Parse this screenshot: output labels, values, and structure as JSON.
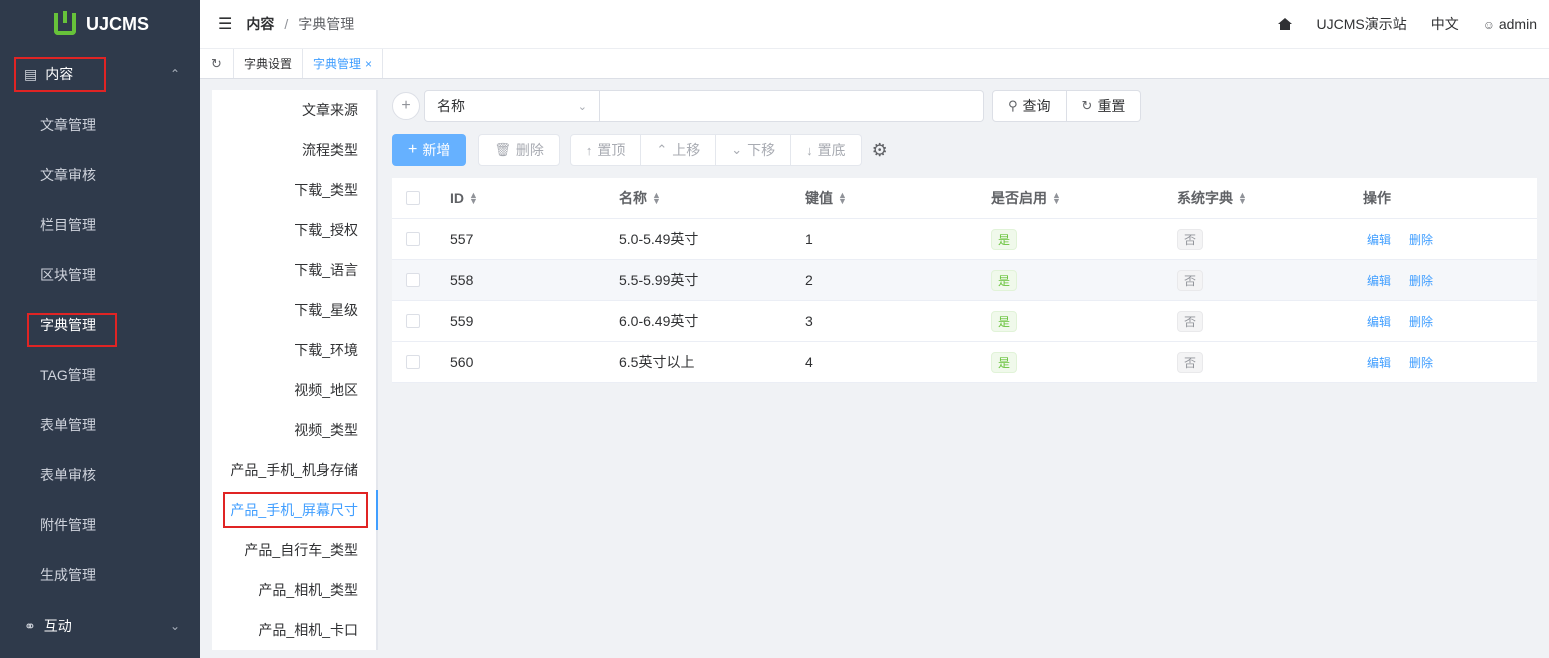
{
  "app": {
    "name": "UJCMS"
  },
  "sidebar": {
    "group_content": "内容",
    "items": [
      {
        "label": "文章管理"
      },
      {
        "label": "文章审核"
      },
      {
        "label": "栏目管理"
      },
      {
        "label": "区块管理"
      },
      {
        "label": "字典管理"
      },
      {
        "label": "TAG管理"
      },
      {
        "label": "表单管理"
      },
      {
        "label": "表单审核"
      },
      {
        "label": "附件管理"
      },
      {
        "label": "生成管理"
      }
    ],
    "group_interact": "互动"
  },
  "header": {
    "breadcrumb_root": "内容",
    "breadcrumb_sep": "/",
    "breadcrumb_current": "字典管理",
    "site": "UJCMS演示站",
    "lang": "中文",
    "user": "admin"
  },
  "tabs": [
    {
      "label": "字典设置"
    },
    {
      "label": "字典管理",
      "close": "×"
    }
  ],
  "dict_types": [
    "文章来源",
    "流程类型",
    "下载_类型",
    "下载_授权",
    "下载_语言",
    "下载_星级",
    "下载_环境",
    "视频_地区",
    "视频_类型",
    "产品_手机_机身存储",
    "产品_手机_屏幕尺寸",
    "产品_自行车_类型",
    "产品_相机_类型",
    "产品_相机_卡口"
  ],
  "search": {
    "field_selected": "名称",
    "query_label": "查询",
    "reset_label": "重置"
  },
  "toolbar": {
    "add_label": "新增",
    "delete_label": "删除",
    "top_label": "置顶",
    "up_label": "上移",
    "down_label": "下移",
    "bottom_label": "置底"
  },
  "table": {
    "headers": {
      "id": "ID",
      "name": "名称",
      "key": "键值",
      "enabled": "是否启用",
      "system": "系统字典",
      "ops": "操作"
    },
    "rows": [
      {
        "id": "557",
        "name": "5.0-5.49英寸",
        "key": "1",
        "enabled": "是",
        "system": "否",
        "edit": "编辑",
        "delete": "删除"
      },
      {
        "id": "558",
        "name": "5.5-5.99英寸",
        "key": "2",
        "enabled": "是",
        "system": "否",
        "edit": "编辑",
        "delete": "删除"
      },
      {
        "id": "559",
        "name": "6.0-6.49英寸",
        "key": "3",
        "enabled": "是",
        "system": "否",
        "edit": "编辑",
        "delete": "删除"
      },
      {
        "id": "560",
        "name": "6.5英寸以上",
        "key": "4",
        "enabled": "是",
        "system": "否",
        "edit": "编辑",
        "delete": "删除"
      }
    ]
  }
}
